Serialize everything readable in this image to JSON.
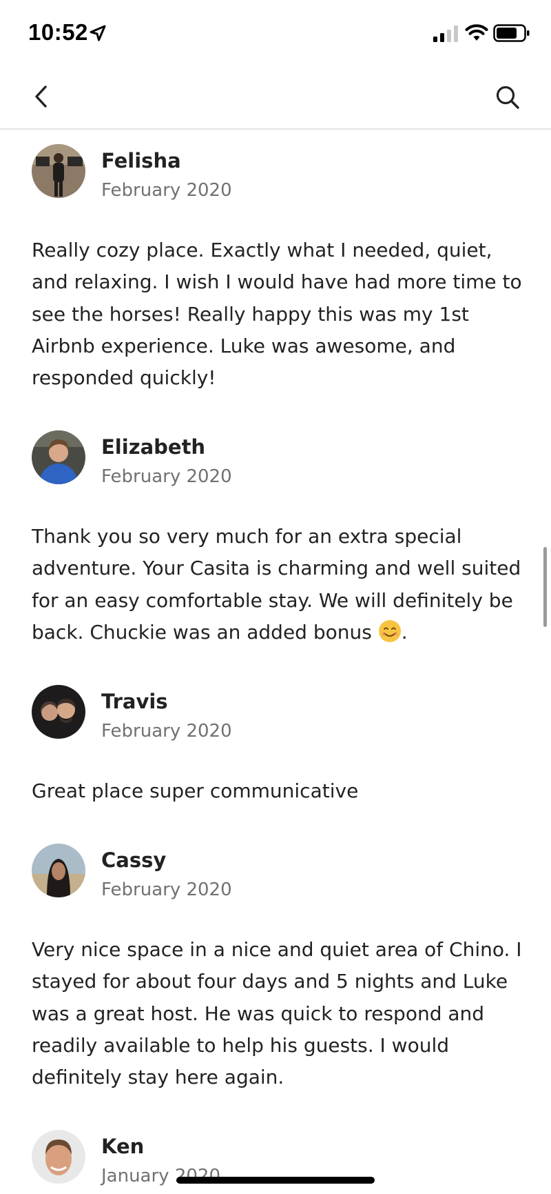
{
  "status_bar": {
    "time": "10:52"
  },
  "icons": {
    "location": "location-arrow-icon",
    "signal": "cellular-signal-icon",
    "wifi": "wifi-icon",
    "battery": "battery-icon",
    "back": "chevron-left-icon",
    "search": "search-icon",
    "emoji": "smiling-face-emoji"
  },
  "colors": {
    "text": "#222222",
    "secondary_text": "#717171",
    "divider": "#e3e3e3"
  },
  "reviews": [
    {
      "name": "Felisha",
      "date": "February 2020",
      "text": "Really cozy place. Exactly what I needed, quiet, and relaxing. I wish I would have had more time to see the horses! Really happy this was my 1st Airbnb experience. Luke was awesome, and responded quickly!"
    },
    {
      "name": "Elizabeth",
      "date": "February 2020",
      "text": "Thank you so very much for an extra special adventure. Your Casita is charming and well suited for an easy comfortable stay. We will definitely be back. Chuckie was an added bonus",
      "text_end": "."
    },
    {
      "name": "Travis",
      "date": "February 2020",
      "text": "Great place super communicative"
    },
    {
      "name": "Cassy",
      "date": "February 2020",
      "text": "Very nice space in a nice and quiet area of Chino. I stayed for about four days and 5 nights and Luke was a great host. He was quick to respond and readily available to help his guests. I would definitely stay here again."
    },
    {
      "name": "Ken",
      "date": "January 2020"
    }
  ]
}
